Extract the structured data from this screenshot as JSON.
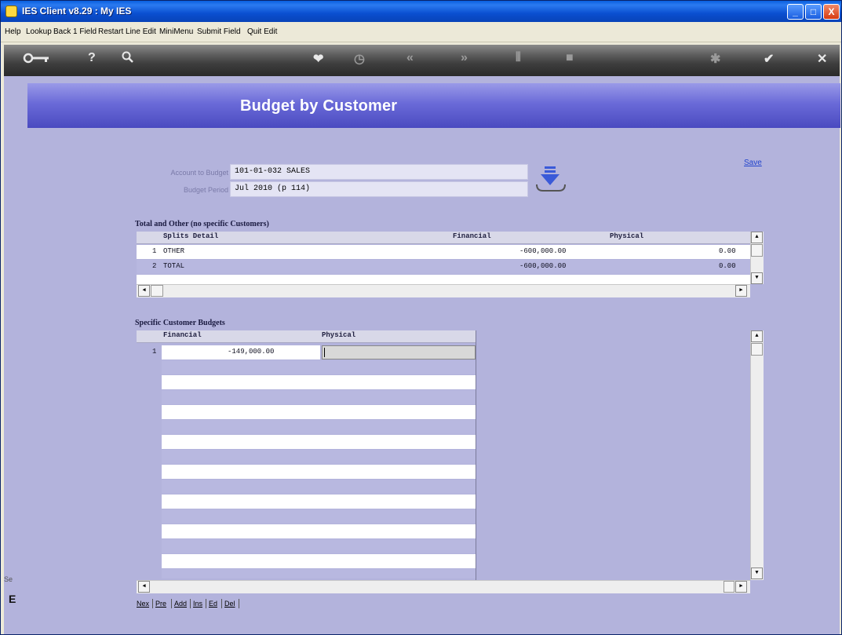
{
  "window": {
    "title": "IES Client v8.29 : My IES",
    "minimize": "_",
    "maximize": "□",
    "close": "X"
  },
  "menu": [
    "Help",
    "Lookup",
    "Back 1 Field",
    "Restart Line Edit",
    "MiniMenu",
    "Submit Field",
    "Quit Edit"
  ],
  "toolbar_icons": [
    "key-icon",
    "help-icon",
    "search-icon",
    "heart-icon",
    "clock-icon",
    "rewind-icon",
    "fast-forward-icon",
    "columns-icon",
    "stop-icon",
    "settings-icon",
    "check-icon",
    "close-icon"
  ],
  "page": {
    "title": "Budget by Customer",
    "save_label": "Save"
  },
  "form": {
    "account_label": "Account to Budget",
    "account_value": "101-01-032 SALES",
    "period_label": "Budget Period",
    "period_value": "Jul 2010 (p 114)"
  },
  "totals": {
    "title": "Total and Other (no specific Customers)",
    "headers": [
      "Splits Detail",
      "Financial",
      "Physical"
    ],
    "rows": [
      {
        "no": "1",
        "detail": "OTHER",
        "financial": "-600,000.00",
        "physical": "0.00"
      },
      {
        "no": "2",
        "detail": "TOTAL",
        "financial": "-600,000.00",
        "physical": "0.00"
      }
    ]
  },
  "customers": {
    "title": "Specific Customer Budgets",
    "headers": [
      "Financial",
      "Physical"
    ],
    "rows": [
      {
        "no": "1",
        "financial": "-149,000.00",
        "physical": ""
      }
    ]
  },
  "nav": [
    "Nex",
    "Pre",
    "Add",
    "Ins",
    "Ed",
    "Del"
  ],
  "left_stub": {
    "text": "Se",
    "letter": "E"
  },
  "colors": {
    "content_bg": "#b3b3dc",
    "banner": "#6a6ad8",
    "row_blue": "#b8b8e0",
    "link": "#2244cc"
  }
}
